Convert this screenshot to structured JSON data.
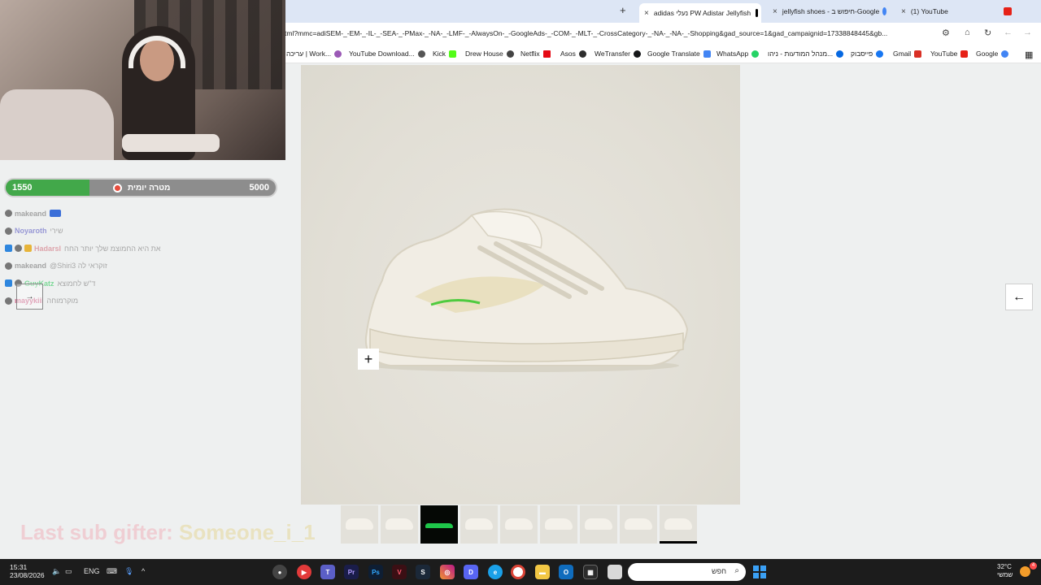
{
  "browser": {
    "tabs": [
      {
        "title": "(1) YouTube",
        "favicon": "youtube-icon",
        "color": "#e62117"
      },
      {
        "title": "jellyfish shoes - חיפוש ב-Google",
        "favicon": "google-icon",
        "color": "#4285f4"
      },
      {
        "title": "adidas נעלי PW Adistar Jellyfish",
        "favicon": "adidas-icon",
        "color": "#000000",
        "active": true
      }
    ],
    "new_tab_label": "+",
    "close_label": "×",
    "url": "tml?mmc=adiSEM-_-EM-_-IL-_-SEA-_-PMax-_-NA-_-LMF-_-AlwaysOn-_-GoogleAds-_-COM-_-MLT-_-CrossCategory-_-NA-_-NA-_-Shopping&gad_source=1&gad_campaignid=17338848445&gb...",
    "bookmarks": [
      {
        "label": "Google",
        "color": "#4285f4"
      },
      {
        "label": "YouTube",
        "color": "#e62117"
      },
      {
        "label": "Gmail",
        "color": "#d93025"
      },
      {
        "label": "פייסבוק",
        "color": "#1877f2"
      },
      {
        "label": "מנהל המודעות - ניהו...",
        "color": "#0668e1"
      },
      {
        "label": "WhatsApp",
        "color": "#25d366"
      },
      {
        "label": "Google Translate",
        "color": "#4285f4"
      },
      {
        "label": "WeTransfer",
        "color": "#17181a"
      },
      {
        "label": "Asos",
        "color": "#2d2d2d"
      },
      {
        "label": "Netflix",
        "color": "#e50914"
      },
      {
        "label": "Drew House",
        "color": "#444444"
      },
      {
        "label": "Kick",
        "color": "#53fc18"
      },
      {
        "label": "YouTube Download...",
        "color": "#555555"
      },
      {
        "label": "עריכה | Work...",
        "color": "#9b59b6"
      }
    ]
  },
  "stream": {
    "goal": {
      "current": "1550",
      "max": "5000",
      "label": "מטרה יומית",
      "progress": 0.31,
      "color": "#42a84a"
    },
    "chat": [
      {
        "user": "makeand",
        "msg": "",
        "color": "#8a8a8a",
        "badge": "#3b6fd8"
      },
      {
        "user": "Noyaroth",
        "msg": "שירי",
        "color": "#7a7acc",
        "badge": "#777777"
      },
      {
        "user": "Hadarsl",
        "msg": "את היא החמוצמ שלך יותר החח",
        "color": "#d88b94",
        "badge": "#2e86de"
      },
      {
        "user": "makeand",
        "msg": "@Shiri3 זוקראי לה",
        "color": "#8a8a8a",
        "badge": "#777777"
      },
      {
        "user": "GuyKatz",
        "msg": "ד\"ש לחמוצא",
        "color": "#56d07a",
        "badge": "#2e86de"
      },
      {
        "user": "mayykiii",
        "msg": "מוקרמוחה",
        "color": "#c4416e",
        "badge": "#777777"
      }
    ],
    "sub_gifter_label": "Last sub gifter:",
    "sub_gifter_name": "Someone_i_1"
  },
  "product": {
    "zoom_label": "+",
    "next_label": "←",
    "thumbnail_count": 9,
    "selected_thumbnail": 9,
    "shoe_color": "#f1ede4",
    "accent_color": "#e7dcb6"
  },
  "taskbar": {
    "time": "15:31",
    "date": "23/08/2026",
    "language": "ENG",
    "search_placeholder": "חפש",
    "weather_temp": "32°C",
    "weather_desc": "שמשי",
    "notification_count": "4"
  }
}
